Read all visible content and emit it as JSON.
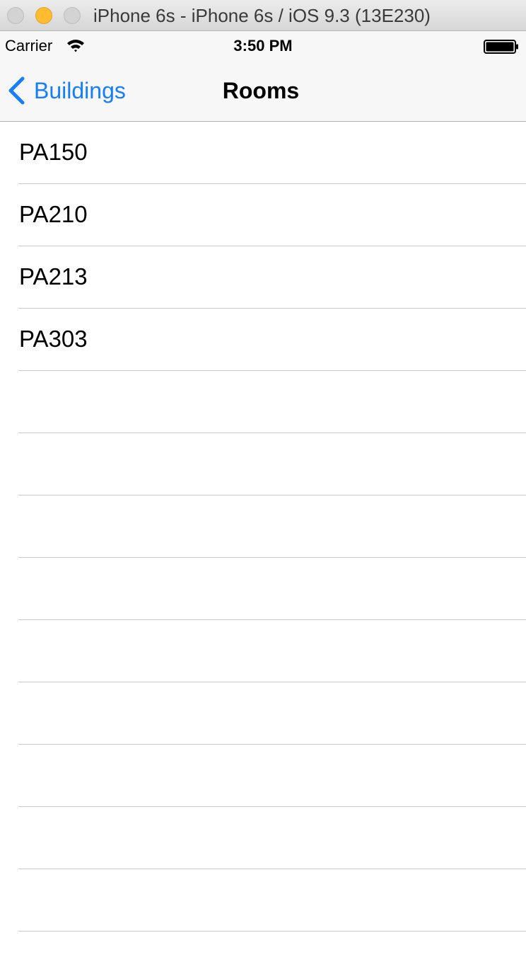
{
  "window": {
    "title": "iPhone 6s - iPhone 6s / iOS 9.3 (13E230)"
  },
  "status_bar": {
    "carrier": "Carrier",
    "time": "3:50 PM",
    "wifi_icon": "wifi-icon",
    "battery_icon": "battery-icon"
  },
  "nav_bar": {
    "back_label": "Buildings",
    "title": "Rooms",
    "tint_color": "#157efb"
  },
  "rooms": [
    {
      "label": "PA150"
    },
    {
      "label": "PA210"
    },
    {
      "label": "PA213"
    },
    {
      "label": "PA303"
    },
    {
      "label": ""
    },
    {
      "label": ""
    },
    {
      "label": ""
    },
    {
      "label": ""
    },
    {
      "label": ""
    },
    {
      "label": ""
    },
    {
      "label": ""
    },
    {
      "label": ""
    },
    {
      "label": ""
    }
  ]
}
